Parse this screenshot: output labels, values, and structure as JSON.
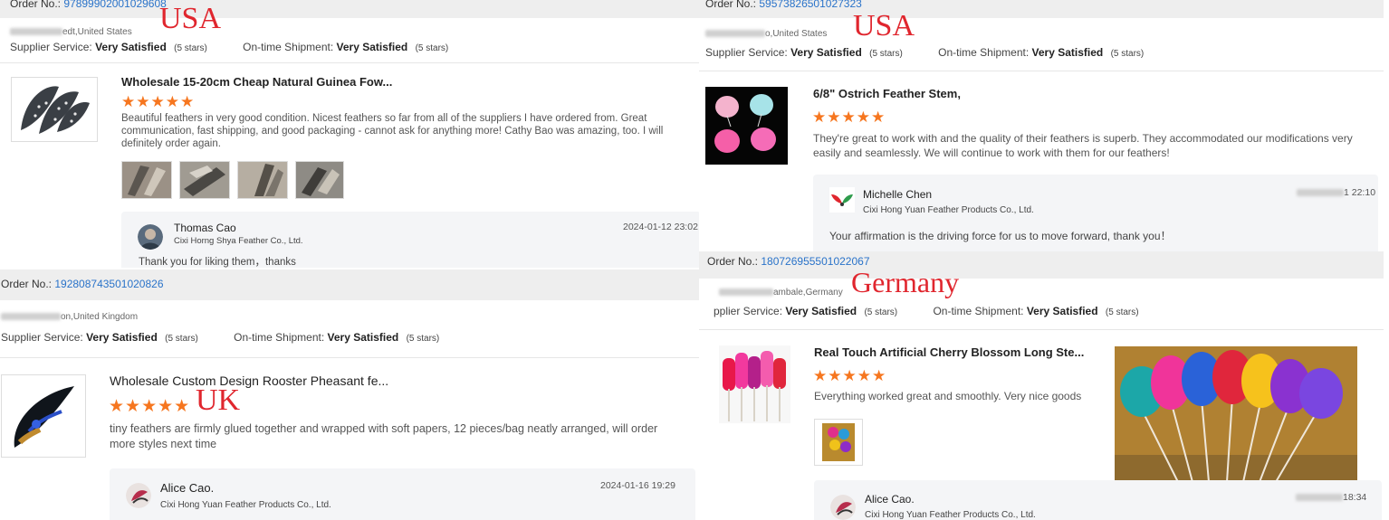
{
  "panels": {
    "p1": {
      "order_label": "Order No.:",
      "order_number": "97899902001029608",
      "country_tag": "USA",
      "buyer_location": "edt,United States",
      "supplier_service_label": "Supplier Service:",
      "supplier_service_value": "Very Satisfied",
      "supplier_service_stars": "(5 stars)",
      "shipment_label": "On-time Shipment:",
      "shipment_value": "Very Satisfied",
      "shipment_stars": "(5 stars)",
      "product_title": "Wholesale 15-20cm Cheap Natural Guinea Fow...",
      "rating_stars": "★★★★★",
      "review_text": "Beautiful feathers in very good condition.  Nicest feathers so far from all of the suppliers I have ordered from.  Great communication, fast shipping, and good packaging - cannot ask for anything more!  Cathy Bao was amazing, too.  I will definitely order again.",
      "reply_name": "Thomas Cao",
      "reply_company": "Cixi Horng Shya Feather Co., Ltd.",
      "reply_date": "2024-01-12 23:02",
      "reply_text": "Thank you for liking them，thanks"
    },
    "p2": {
      "order_label": "Order No.:",
      "order_number": "59573826501027323",
      "country_tag": "USA",
      "buyer_location": "o,United States",
      "supplier_service_label": "Supplier Service:",
      "supplier_service_value": "Very Satisfied",
      "supplier_service_stars": "(5 stars)",
      "shipment_label": "On-time Shipment:",
      "shipment_value": "Very Satisfied",
      "shipment_stars": "(5 stars)",
      "product_title": "6/8\" Ostrich Feather Stem,",
      "rating_stars": "★★★★★",
      "review_text": "They're great to work with and the quality of their feathers is superb.  They accommodated our modifications very easily and seamlessly.  We will continue to work with them for our feathers!",
      "reply_name": "Michelle Chen",
      "reply_company": "Cixi Hong Yuan Feather Products Co., Ltd.",
      "reply_date": "1 22:10",
      "reply_text": "Your affirmation is the driving force for us to move forward, thank you！"
    },
    "p3": {
      "order_label": "Order No.:",
      "order_number": "192808743501020826",
      "country_tag": "UK",
      "buyer_location": "on,United Kingdom",
      "supplier_service_label": "Supplier Service:",
      "supplier_service_value": "Very Satisfied",
      "supplier_service_stars": "(5 stars)",
      "shipment_label": "On-time Shipment:",
      "shipment_value": "Very Satisfied",
      "shipment_stars": "(5 stars)",
      "product_title": "Wholesale Custom Design Rooster Pheasant fe...",
      "rating_stars": "★★★★★",
      "review_text": "tiny feathers are firmly glued together and wrapped with soft papers, 12 pieces/bag neatly arranged, will order more styles next time",
      "reply_name": "Alice Cao.",
      "reply_company": "Cixi Hong Yuan Feather Products Co., Ltd.",
      "reply_date": "2024-01-16 19:29"
    },
    "p4": {
      "order_label": "Order No.:",
      "order_number": "180726955501022067",
      "country_tag": "Germany",
      "buyer_location": "ambale,Germany",
      "supplier_service_label": "pplier Service:",
      "supplier_service_value": "Very Satisfied",
      "supplier_service_stars": "(5 stars)",
      "shipment_label": "On-time Shipment:",
      "shipment_value": "Very Satisfied",
      "shipment_stars": "(5 stars)",
      "product_title": "Real Touch Artificial Cherry Blossom Long Ste...",
      "rating_stars": "★★★★★",
      "review_text": "Everything worked great and smoothly. Very nice goods",
      "reply_name": "Alice Cao.",
      "reply_company": "Cixi Hong Yuan Feather Products Co., Ltd.",
      "reply_date": "18:34"
    }
  },
  "colors": {
    "accent_order": "#2a73c9",
    "star": "#f6761f",
    "tag": "#e0262e"
  }
}
